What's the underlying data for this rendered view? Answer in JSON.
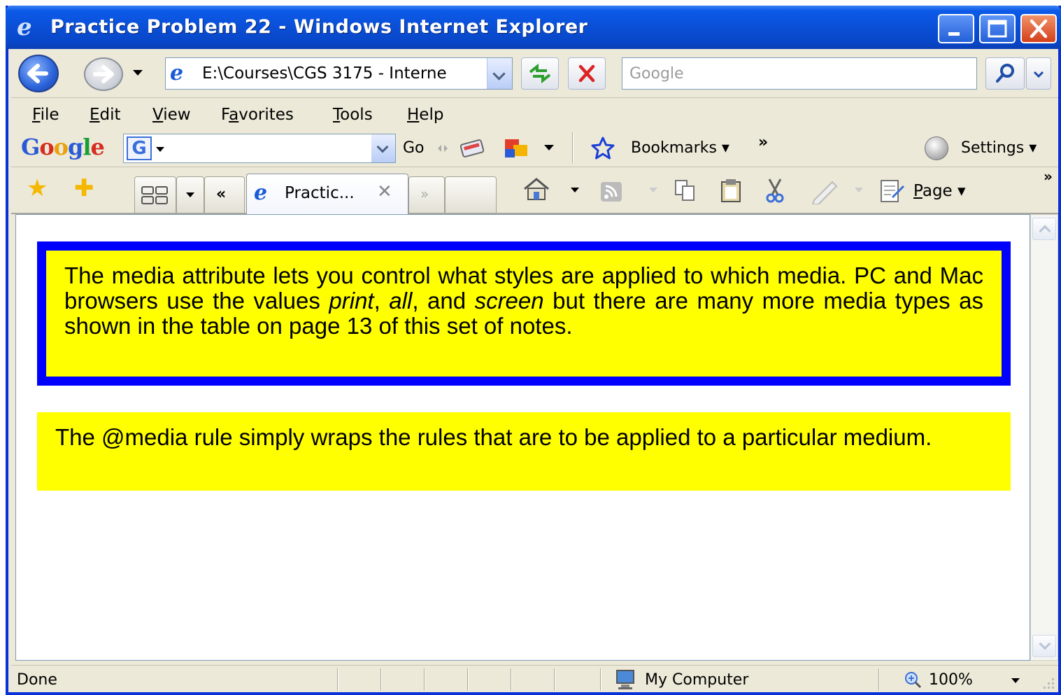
{
  "window": {
    "title": "Practice Problem 22 - Windows Internet Explorer"
  },
  "address_bar": {
    "url": "E:\\Courses\\CGS 3175 - Interne"
  },
  "search": {
    "placeholder": "Google"
  },
  "menu": {
    "items": [
      {
        "label": "File",
        "key": "F",
        "rest": "ile"
      },
      {
        "label": "Edit",
        "key": "E",
        "rest": "dit"
      },
      {
        "label": "View",
        "key": "V",
        "rest": "iew"
      },
      {
        "label": "Favorites",
        "pre": "F",
        "key": "a",
        "rest": "vorites"
      },
      {
        "label": "Tools",
        "key": "T",
        "rest": "ools"
      },
      {
        "label": "Help",
        "key": "H",
        "rest": "elp"
      }
    ]
  },
  "google_toolbar": {
    "logo_letters": [
      "G",
      "o",
      "o",
      "g",
      "l",
      "e"
    ],
    "logo_colors": [
      "#2a5bd7",
      "#d62d20",
      "#e8a20c",
      "#2a5bd7",
      "#199e35",
      "#d62d20"
    ],
    "go_label": "Go",
    "bookmarks_label": "Bookmarks",
    "more_label": "»",
    "settings_label": "Settings"
  },
  "tabs": {
    "active_tab_label": "Practic...",
    "back_arrows": "«",
    "forward_arrows": "»",
    "command_more": "»",
    "page_label": "Page"
  },
  "content": {
    "box1": {
      "part1": "The media attribute lets you control what styles are applied to which media. PC and Mac browsers use the values ",
      "em1": "print",
      "sep1": ", ",
      "em2": "all",
      "sep2": ", and ",
      "em3": "screen",
      "part2": " but there are many more media types as shown in the table on page 13 of this set of notes."
    },
    "box2": {
      "text": "The @media rule simply wraps the rules that are to be applied to a particular medium."
    }
  },
  "status_bar": {
    "status": "Done",
    "zone": "My Computer",
    "zoom": "100%"
  },
  "colors": {
    "titlebar_blue": "#0a4fd6",
    "box_yellow": "#ffff00",
    "box_border_blue": "#0000ff"
  }
}
